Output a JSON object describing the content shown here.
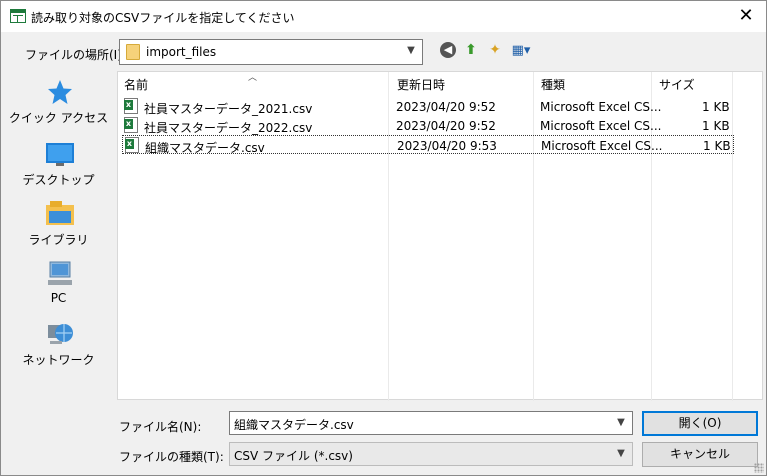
{
  "window": {
    "title": "読み取り対象のCSVファイルを指定してください",
    "close_glyph": "✕"
  },
  "location": {
    "label": "ファイルの場所(I):",
    "value": "import_files"
  },
  "places": [
    {
      "label": "クイック アクセス",
      "icon": "quick-access-star-icon"
    },
    {
      "label": "デスクトップ",
      "icon": "desktop-icon"
    },
    {
      "label": "ライブラリ",
      "icon": "library-icon"
    },
    {
      "label": "PC",
      "icon": "pc-icon"
    },
    {
      "label": "ネットワーク",
      "icon": "network-icon"
    }
  ],
  "columns": {
    "name": "名前",
    "modified": "更新日時",
    "type": "種類",
    "size": "サイズ"
  },
  "files": [
    {
      "name": "社員マスターデータ_2021.csv",
      "modified": "2023/04/20 9:52",
      "type": "Microsoft Excel CS...",
      "size": "1 KB"
    },
    {
      "name": "社員マスターデータ_2022.csv",
      "modified": "2023/04/20 9:52",
      "type": "Microsoft Excel CS...",
      "size": "1 KB"
    },
    {
      "name": "組織マスタデータ.csv",
      "modified": "2023/04/20 9:53",
      "type": "Microsoft Excel CS...",
      "size": "1 KB"
    }
  ],
  "filename": {
    "label": "ファイル名(N):",
    "value": "組織マスタデータ.csv"
  },
  "filetype": {
    "label": "ファイルの種類(T):",
    "value": "CSV ファイル (*.csv)"
  },
  "buttons": {
    "open": "開く(O)",
    "cancel": "キャンセル"
  },
  "colors": {
    "excel_green": "#1e7a3c",
    "default_button_border": "#0078d7"
  }
}
